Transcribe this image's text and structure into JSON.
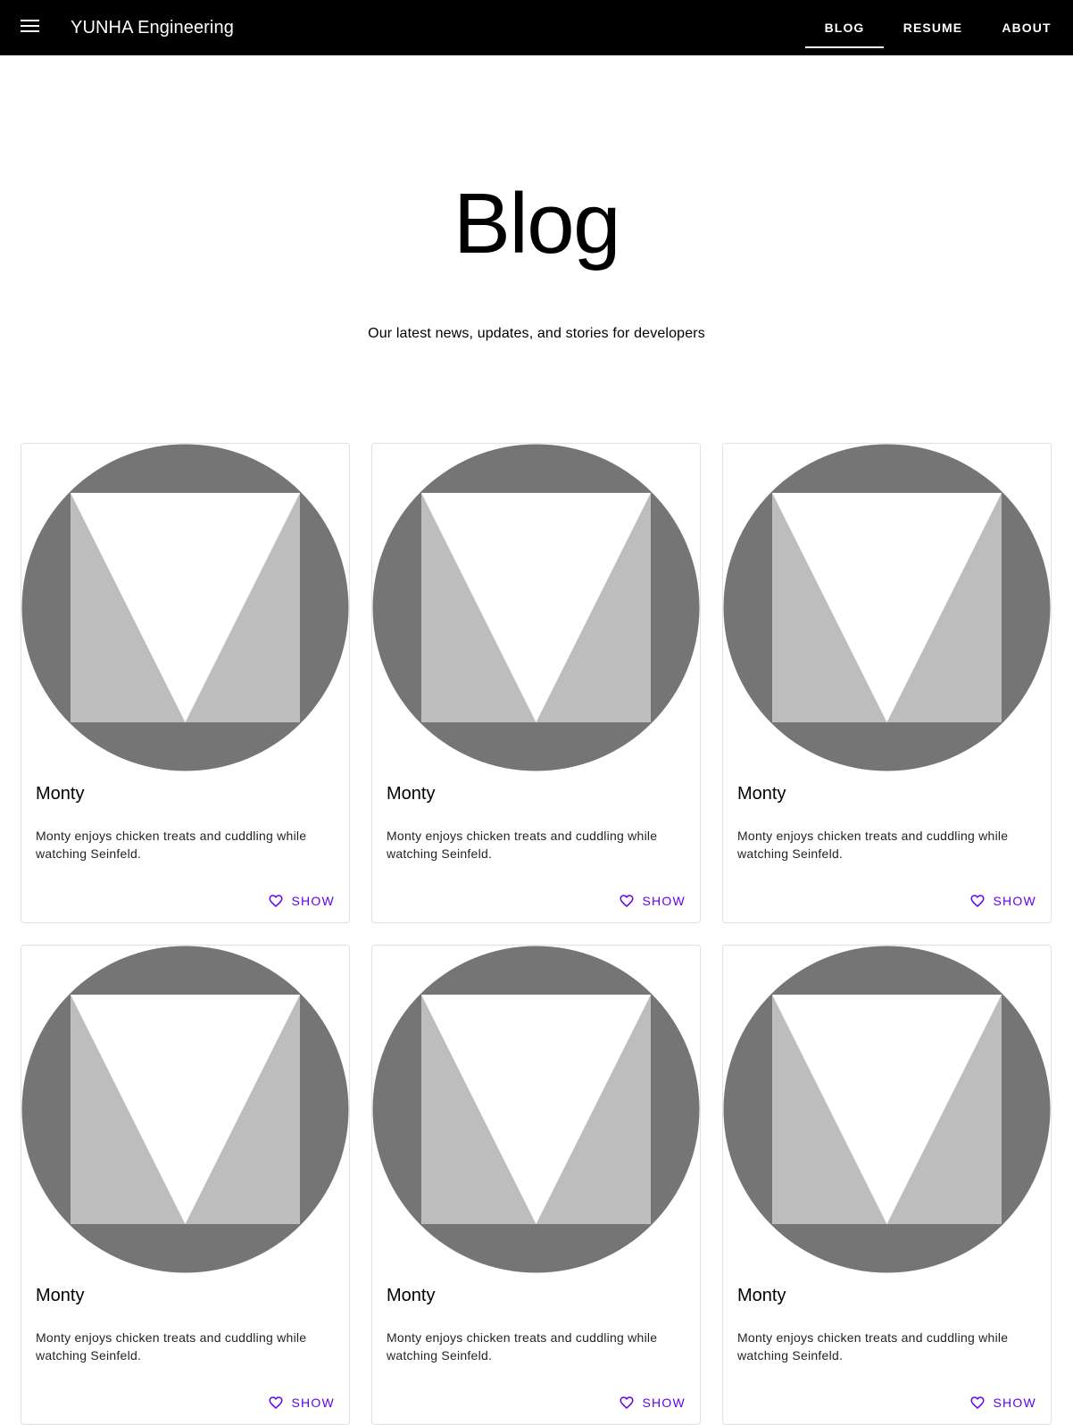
{
  "header": {
    "brand": "YUNHA Engineering",
    "menu_icon": "menu-icon",
    "tabs": [
      {
        "label": "BLOG",
        "active": true
      },
      {
        "label": "RESUME",
        "active": false
      },
      {
        "label": "ABOUT",
        "active": false
      }
    ]
  },
  "hero": {
    "title": "Blog",
    "subtitle": "Our latest news, updates, and stories for developers"
  },
  "cards": [
    {
      "title": "Monty",
      "description": "Monty enjoys chicken treats and cuddling while watching Seinfeld.",
      "action": "SHOW",
      "action_icon": "heart-outline-icon"
    },
    {
      "title": "Monty",
      "description": "Monty enjoys chicken treats and cuddling while watching Seinfeld.",
      "action": "SHOW",
      "action_icon": "heart-outline-icon"
    },
    {
      "title": "Monty",
      "description": "Monty enjoys chicken treats and cuddling while watching Seinfeld.",
      "action": "SHOW",
      "action_icon": "heart-outline-icon"
    },
    {
      "title": "Monty",
      "description": "Monty enjoys chicken treats and cuddling while watching Seinfeld.",
      "action": "SHOW",
      "action_icon": "heart-outline-icon"
    },
    {
      "title": "Monty",
      "description": "Monty enjoys chicken treats and cuddling while watching Seinfeld.",
      "action": "SHOW",
      "action_icon": "heart-outline-icon"
    },
    {
      "title": "Monty",
      "description": "Monty enjoys chicken treats and cuddling while watching Seinfeld.",
      "action": "SHOW",
      "action_icon": "heart-outline-icon"
    }
  ],
  "colors": {
    "topbar": "#000000",
    "accent": "#6200ee",
    "placeholder_dark": "#757575",
    "placeholder_light": "#bdbdbd"
  }
}
